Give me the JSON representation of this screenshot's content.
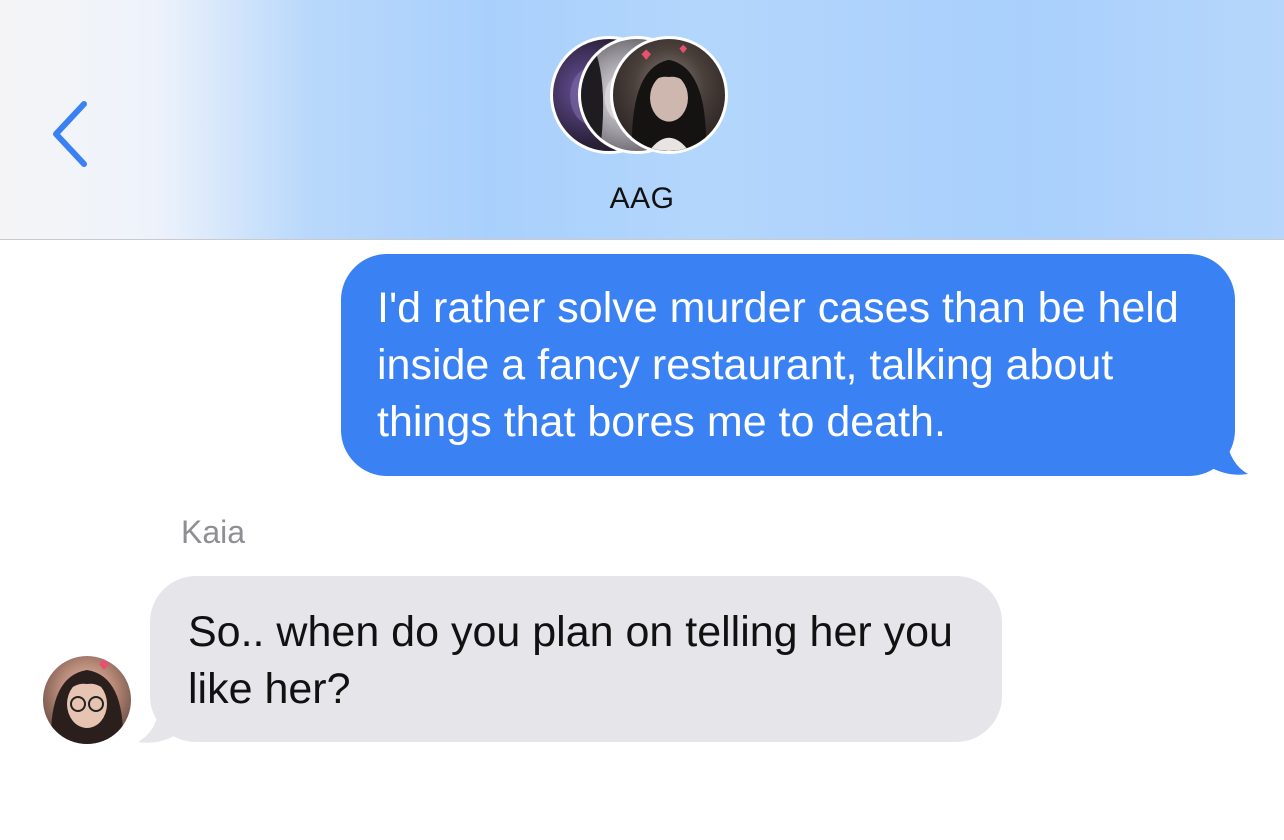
{
  "header": {
    "back_icon": "chevron-left-icon",
    "group_name": "AAG",
    "accent_color": "#3a81f3"
  },
  "messages": [
    {
      "direction": "outgoing",
      "text": "I'd rather solve murder cases than be held inside a fancy restaurant, talking about things that bores me to death.",
      "bubble_color": "#3a81f3"
    },
    {
      "direction": "incoming",
      "sender": "Kaia",
      "text": "So.. when do you plan on telling her you like her?",
      "bubble_color": "#e5e5ea"
    }
  ]
}
